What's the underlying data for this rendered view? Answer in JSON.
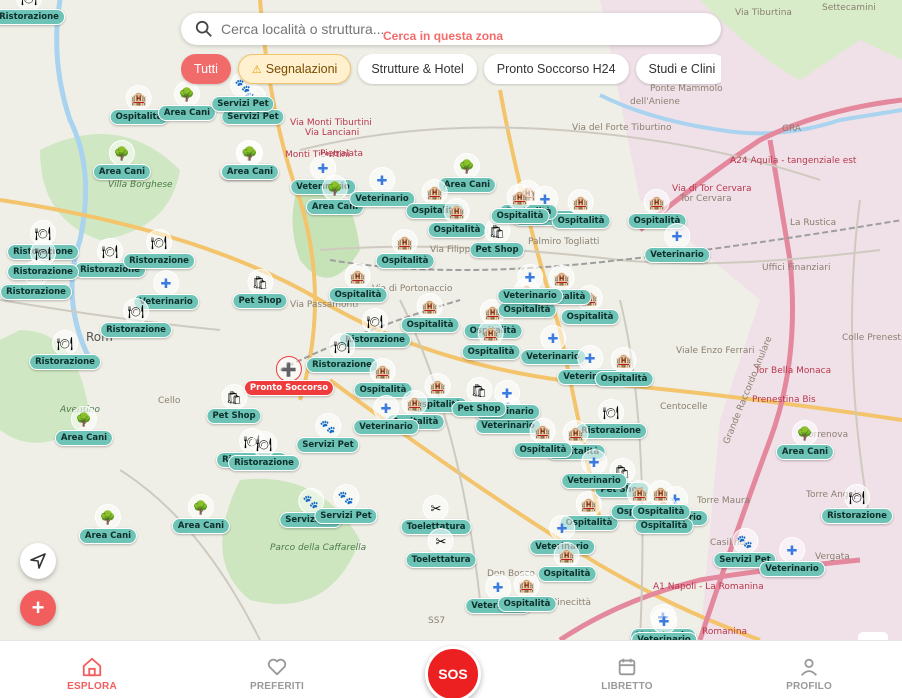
{
  "search": {
    "placeholder": "Cerca località o struttura...",
    "area_button": "Cerca in questa zona"
  },
  "filters": [
    {
      "label": "Tutti",
      "state": "active"
    },
    {
      "label": "Segnalazioni",
      "state": "warning",
      "icon": "warning-icon"
    },
    {
      "label": "Strutture & Hotel",
      "state": "idle"
    },
    {
      "label": "Pronto Soccorso H24",
      "state": "idle"
    },
    {
      "label": "Studi e Clini",
      "state": "idle"
    }
  ],
  "colors": {
    "accent": "#f25d5d",
    "marker_label": "#6cc3b6",
    "emergency": "#ef3b3b"
  },
  "map": {
    "streets": [
      {
        "text": "Via Tiburtina"
      },
      {
        "text": "Ponte Mammolo"
      },
      {
        "text": "dell'Aniene"
      },
      {
        "text": "Via Monti Tiburtini"
      },
      {
        "text": "Via Lanciani"
      },
      {
        "text": "Monti Tiburtini"
      },
      {
        "text": "Pietralata"
      },
      {
        "text": "Via del Forte Tiburtino"
      },
      {
        "text": "GRA"
      },
      {
        "text": "A24 Aquila - tangenziale est"
      },
      {
        "text": "Via di Tor Cervara"
      },
      {
        "text": "Tor Cervara"
      },
      {
        "text": "La Rustica"
      },
      {
        "text": "Uffici Finanziari"
      },
      {
        "text": "Villa Borghese"
      },
      {
        "text": "Palmiro Togliatti"
      },
      {
        "text": "Via Filippo Fiorentini"
      },
      {
        "text": "Via di Portonaccio"
      },
      {
        "text": "Via Passamonti"
      },
      {
        "text": "Colle Prenestino"
      },
      {
        "text": "Tor Bella Monaca"
      },
      {
        "text": "Viale Enzo Ferrari"
      },
      {
        "text": "Prenestina Bis"
      },
      {
        "text": "Torrenova"
      },
      {
        "text": "Torre Angela"
      },
      {
        "text": "Torre Maura"
      },
      {
        "text": "Grande Raccordo Anulare"
      },
      {
        "text": "Centocelle"
      },
      {
        "text": "Parco della Caffarella"
      },
      {
        "text": "Casilino"
      },
      {
        "text": "Vergata"
      },
      {
        "text": "Don Bosco"
      },
      {
        "text": "Cinecittà"
      },
      {
        "text": "A1 Napoli - La Romanina"
      },
      {
        "text": "Romanina"
      },
      {
        "text": "Rom"
      },
      {
        "text": "Cello"
      },
      {
        "text": "Aventino"
      },
      {
        "text": "SS7"
      },
      {
        "text": "Settecamini"
      }
    ],
    "markers": [
      {
        "label": "Ristorazione",
        "icon": "restaurant-icon"
      },
      {
        "label": "Ospitalità",
        "icon": "hotel-icon"
      },
      {
        "label": "Area Cani",
        "icon": "tree-icon"
      },
      {
        "label": "Area Cani",
        "icon": "tree-icon"
      },
      {
        "label": "Servizi Pet",
        "icon": "pet-service-icon"
      },
      {
        "label": "Area Cani",
        "icon": "tree-icon"
      },
      {
        "label": "Servizi Pet",
        "icon": "pet-service-icon"
      },
      {
        "label": "Veterinario",
        "icon": "vet-icon"
      },
      {
        "label": "Area Cani",
        "icon": "tree-icon"
      },
      {
        "label": "Area Cani",
        "icon": "tree-icon"
      },
      {
        "label": "Veterinario",
        "icon": "vet-icon"
      },
      {
        "label": "Ospitalità",
        "icon": "hotel-icon"
      },
      {
        "label": "Ospitalità",
        "icon": "hotel-icon"
      },
      {
        "label": "Veterinario",
        "icon": "vet-icon"
      },
      {
        "label": "Pet Shop",
        "icon": "shop-icon"
      },
      {
        "label": "Ristorazione",
        "icon": "restaurant-icon"
      },
      {
        "label": "Ristorazione",
        "icon": "restaurant-icon"
      },
      {
        "label": "Ristorazione",
        "icon": "restaurant-icon"
      },
      {
        "label": "Ristorazione",
        "icon": "restaurant-icon"
      },
      {
        "label": "Ristorazione",
        "icon": "restaurant-icon"
      },
      {
        "label": "Pet Shop",
        "icon": "shop-icon"
      },
      {
        "label": "Veterinario",
        "icon": "vet-icon"
      },
      {
        "label": "Ospitalità",
        "icon": "hotel-icon"
      },
      {
        "label": "Ospitalità",
        "icon": "hotel-icon"
      },
      {
        "label": "Ospitalità",
        "icon": "hotel-icon"
      },
      {
        "label": "Ristorazione",
        "icon": "restaurant-icon"
      },
      {
        "label": "Ristorazione",
        "icon": "restaurant-icon"
      },
      {
        "label": "Ospitalità",
        "icon": "hotel-icon"
      },
      {
        "label": "Ospitalità",
        "icon": "hotel-icon"
      },
      {
        "label": "Ospitalità",
        "icon": "hotel-icon"
      },
      {
        "label": "Veterinario",
        "icon": "vet-icon"
      },
      {
        "label": "Ospitalità",
        "icon": "hotel-icon"
      },
      {
        "label": "Ospitalità",
        "icon": "hotel-icon"
      },
      {
        "label": "Pronto Soccorso",
        "icon": "emergency-icon",
        "emergency": true
      },
      {
        "label": "Pet Shop",
        "icon": "shop-icon"
      },
      {
        "label": "Area Cani",
        "icon": "tree-icon"
      },
      {
        "label": "Ristorazione",
        "icon": "restaurant-icon"
      },
      {
        "label": "Ristorazione",
        "icon": "restaurant-icon"
      },
      {
        "label": "Servizi Pet",
        "icon": "pet-service-icon"
      },
      {
        "label": "Area Cani",
        "icon": "tree-icon"
      },
      {
        "label": "Veterinario",
        "icon": "vet-icon"
      },
      {
        "label": "Ospitalità",
        "icon": "hotel-icon"
      },
      {
        "label": "Veterinario",
        "icon": "vet-icon"
      },
      {
        "label": "Ospitalità",
        "icon": "hotel-icon"
      },
      {
        "label": "Ristorazione",
        "icon": "restaurant-icon"
      },
      {
        "label": "Ospitalità",
        "icon": "hotel-icon"
      },
      {
        "label": "Veterinario",
        "icon": "vet-icon"
      },
      {
        "label": "Ospitalità",
        "icon": "hotel-icon"
      },
      {
        "label": "Ospitalità",
        "icon": "hotel-icon"
      },
      {
        "label": "Veterinario",
        "icon": "vet-icon"
      },
      {
        "label": "Ospitalità",
        "icon": "hotel-icon"
      },
      {
        "label": "Veterinario",
        "icon": "vet-icon"
      },
      {
        "label": "Ospitalità",
        "icon": "hotel-icon"
      },
      {
        "label": "Ospitalità",
        "icon": "hotel-icon"
      },
      {
        "label": "Veterinario",
        "icon": "vet-icon"
      },
      {
        "label": "Ospitalità",
        "icon": "hotel-icon"
      },
      {
        "label": "Pet Shop",
        "icon": "shop-icon"
      },
      {
        "label": "Veterinario",
        "icon": "vet-icon"
      },
      {
        "label": "Ristorazione",
        "icon": "restaurant-icon"
      },
      {
        "label": "Veterinario",
        "icon": "vet-icon"
      },
      {
        "label": "Ospitalità",
        "icon": "hotel-icon"
      },
      {
        "label": "Area Cani",
        "icon": "tree-icon"
      },
      {
        "label": "Area Cani",
        "icon": "tree-icon"
      },
      {
        "label": "Servizi Pet",
        "icon": "pet-service-icon"
      },
      {
        "label": "Servizi Pet",
        "icon": "pet-service-icon"
      },
      {
        "label": "Toelettatura",
        "icon": "grooming-icon"
      },
      {
        "label": "Veterinario",
        "icon": "vet-icon"
      },
      {
        "label": "Ospitalità",
        "icon": "hotel-icon"
      },
      {
        "label": "Veterinario",
        "icon": "vet-icon"
      },
      {
        "label": "Ospitalità",
        "icon": "hotel-icon"
      },
      {
        "label": "Toelettatura",
        "icon": "grooming-icon"
      },
      {
        "label": "Servizi Pet",
        "icon": "pet-service-icon"
      },
      {
        "label": "Veterinario",
        "icon": "vet-icon"
      },
      {
        "label": "Area Cani",
        "icon": "tree-icon"
      },
      {
        "label": "Ristorazione",
        "icon": "restaurant-icon"
      },
      {
        "label": "Ospitalità",
        "icon": "hotel-icon"
      },
      {
        "label": "Veterinario",
        "icon": "vet-icon"
      },
      {
        "label": "Ristorazione",
        "icon": "restaurant-icon"
      },
      {
        "label": "Ospitalità",
        "icon": "hotel-icon"
      },
      {
        "label": "Pet Shop",
        "icon": "shop-icon"
      },
      {
        "label": "Ospitalità",
        "icon": "hotel-icon"
      },
      {
        "label": "Ospitalità",
        "icon": "hotel-icon"
      },
      {
        "label": "Veterinario",
        "icon": "vet-icon"
      }
    ]
  },
  "nav": {
    "items": [
      {
        "label": "ESPLORA",
        "icon": "home-icon",
        "active": true
      },
      {
        "label": "PREFERITI",
        "icon": "heart-icon",
        "active": false
      },
      {
        "label": "LIBRETTO",
        "icon": "calendar-icon",
        "active": false
      },
      {
        "label": "PROFILO",
        "icon": "profile-icon",
        "active": false
      }
    ],
    "sos_label": "SOS"
  }
}
